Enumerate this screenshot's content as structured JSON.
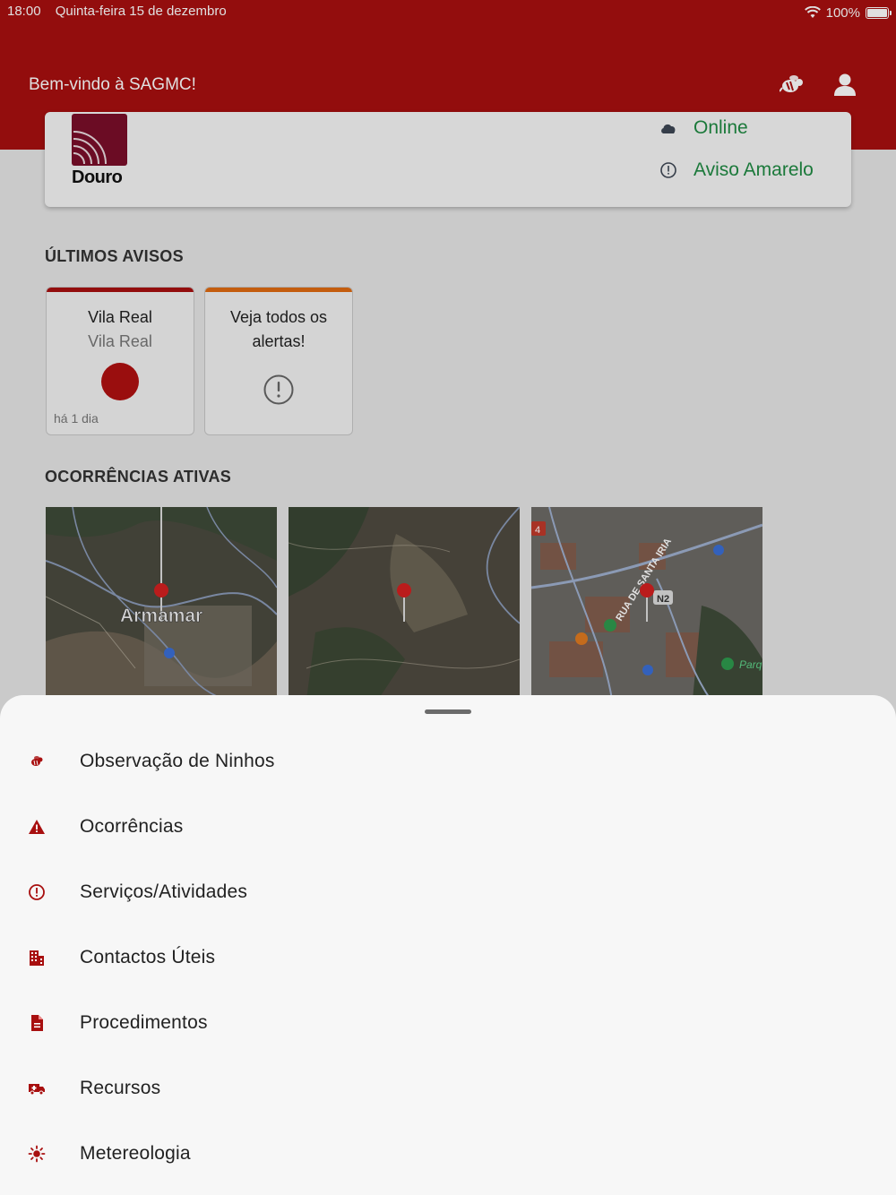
{
  "status_bar": {
    "time": "18:00",
    "date": "Quinta-feira 15 de dezembro",
    "battery": "100%"
  },
  "header": {
    "welcome": "Bem-vindo à SAGMC!"
  },
  "info_card": {
    "logo_text": "Douro",
    "connection": "Online",
    "warning": "Aviso Amarelo"
  },
  "sections": {
    "alerts_title": "ÚLTIMOS AVISOS",
    "occurrences_title": "OCORRÊNCIAS ATIVAS"
  },
  "alerts": [
    {
      "title": "Vila Real",
      "subtitle": "Vila Real",
      "time": "há 1 dia",
      "color": "#a80f0f"
    },
    {
      "title": "Veja todos os alertas!",
      "color": "#e06a10"
    }
  ],
  "maps": [
    {
      "place_label": "Armamar"
    },
    {
      "place_label": ""
    },
    {
      "street_label": "RUA DE SANTA IRIA",
      "road_label": "N2",
      "poi_label": "Parq",
      "side_label": "4"
    }
  ],
  "menu": [
    {
      "label": "Observação de Ninhos",
      "icon": "hornet-icon"
    },
    {
      "label": "Ocorrências",
      "icon": "warning-triangle-icon"
    },
    {
      "label": "Serviços/Atividades",
      "icon": "alert-circle-icon"
    },
    {
      "label": "Contactos Úteis",
      "icon": "building-icon"
    },
    {
      "label": "Procedimentos",
      "icon": "document-icon"
    },
    {
      "label": "Recursos",
      "icon": "ambulance-icon"
    },
    {
      "label": "Metereologia",
      "icon": "sun-icon"
    }
  ],
  "colors": {
    "brand_red": "#a80f0f",
    "online_green": "#1f8a43",
    "orange": "#e06a10"
  }
}
